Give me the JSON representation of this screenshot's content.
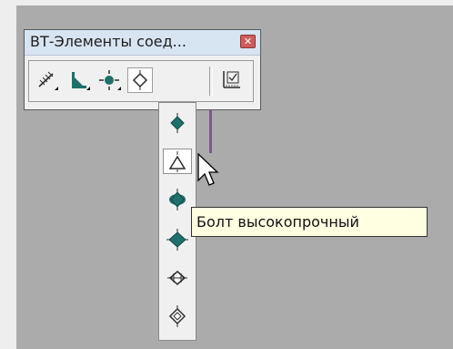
{
  "window": {
    "title": "ВТ-Элементы соед...",
    "close_icon": "close-icon"
  },
  "toolbar": {
    "buttons": [
      {
        "name": "weld-line-icon",
        "has_dropdown": true
      },
      {
        "name": "angle-weld-icon",
        "has_dropdown": true
      },
      {
        "name": "point-node-icon",
        "has_dropdown": true
      },
      {
        "name": "bolt-diamond-icon",
        "has_dropdown": false,
        "active": true
      },
      {
        "name": "table-icon",
        "has_dropdown": false
      }
    ]
  },
  "dropdown": {
    "items": [
      {
        "name": "bolt-filled-diamond-icon"
      },
      {
        "name": "bolt-triangle-icon",
        "hovered": true
      },
      {
        "name": "bolt-filled-circle-diamond-icon"
      },
      {
        "name": "bolt-filled-diamond-wide-icon"
      },
      {
        "name": "bolt-open-diamond-icon"
      },
      {
        "name": "bolt-open-diamond-tall-icon"
      }
    ]
  },
  "tooltip": {
    "text": "Болт высокопрочный"
  },
  "colors": {
    "canvas_bg": "#ababab",
    "title_bar_bg": "#d7e4f2",
    "icon_teal": "#1f6f6b",
    "tooltip_bg": "#ffffe1"
  }
}
